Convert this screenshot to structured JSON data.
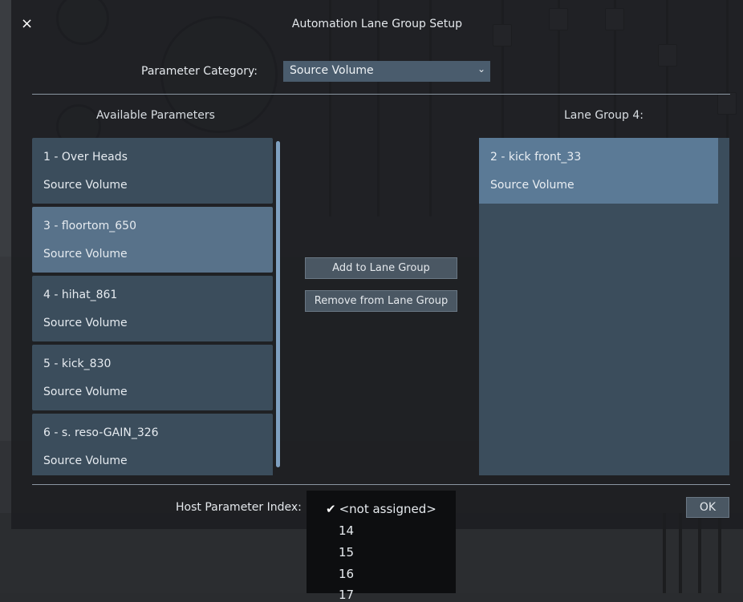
{
  "dialog": {
    "title": "Automation Lane Group Setup",
    "close_icon": "×"
  },
  "category": {
    "label": "Parameter Category:",
    "selected": "Source Volume",
    "chevron_icon": "chevron-down-icon"
  },
  "available": {
    "heading": "Available Parameters",
    "items": [
      {
        "name": "1 - Over Heads",
        "category": "Source Volume",
        "selected": false
      },
      {
        "name": "3 - floortom_650",
        "category": "Source Volume",
        "selected": true
      },
      {
        "name": "4 - hihat_861",
        "category": "Source Volume",
        "selected": false
      },
      {
        "name": "5 - kick_830",
        "category": "Source Volume",
        "selected": false
      },
      {
        "name": "6 - s. reso-GAIN_326",
        "category": "Source Volume",
        "selected": false
      }
    ]
  },
  "actions": {
    "add": "Add to Lane Group",
    "remove": "Remove from Lane Group"
  },
  "lane_group": {
    "heading": "Lane Group 4:",
    "items": [
      {
        "name": "2 - kick front_33",
        "category": "Source Volume"
      }
    ]
  },
  "host_parameter": {
    "label": "Host Parameter Index:",
    "check": "✔",
    "selected": "<not assigned>",
    "options": [
      "14",
      "15",
      "16",
      "17"
    ]
  },
  "ok_label": "OK",
  "colors": {
    "accent_selected": "#58728a",
    "list_item": "#3b4d5c",
    "lane_item": "#5b7a96",
    "scrollbar": "#7fa0c0"
  }
}
